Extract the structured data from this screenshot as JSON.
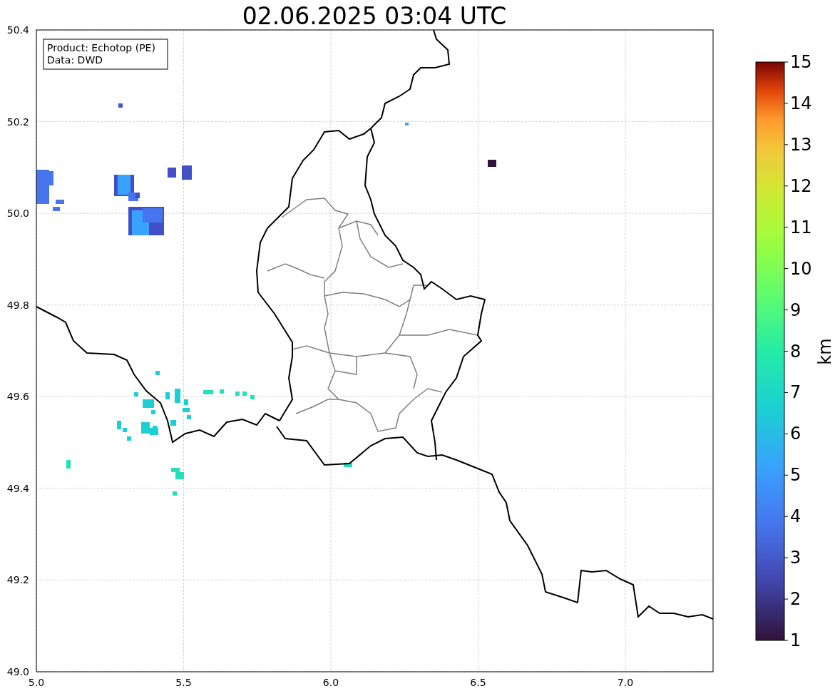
{
  "title": "02.06.2025 03:04 UTC",
  "info_box": {
    "lines": [
      "Product: Echotop (PE)",
      "Data: DWD"
    ]
  },
  "x_axis": {
    "ticks": [
      "5.0",
      "5.5",
      "6.0",
      "6.5",
      "7.0"
    ]
  },
  "y_axis": {
    "ticks": [
      "50.4",
      "50.2",
      "50.0",
      "49.8",
      "49.6",
      "49.4",
      "49.2",
      "49.0"
    ]
  },
  "colorbar": {
    "label": "km",
    "ticks": [
      "15",
      "14",
      "13",
      "12",
      "11",
      "10",
      "9",
      "8",
      "7",
      "6",
      "5",
      "4",
      "3",
      "2",
      "1"
    ]
  }
}
